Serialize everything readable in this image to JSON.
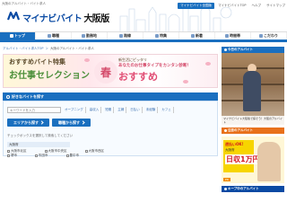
{
  "header": {
    "tagline": "大阪のアルバイト・バイト求人",
    "logo_main": "マイナビ",
    "logo_sub": "バイト",
    "logo_region": "大阪版",
    "top_links": [
      "マイナビバイト全国版",
      "マイナビバイトTOP",
      "ヘルプ",
      "サイトマップ"
    ]
  },
  "nav": {
    "items": [
      "トップ",
      "職種",
      "勤務地",
      "路線",
      "特集",
      "新着",
      "時間帯",
      "こだわり"
    ]
  },
  "breadcrumb": {
    "items": [
      "アルバイト・バイト求人TOP",
      "大阪のアルバイト・バイト求人"
    ]
  },
  "banner": {
    "line1": "おすすめバイト特集",
    "line2": "お仕事セレクション",
    "haru": "春",
    "right1": "新生活にピッタリ",
    "right2": "あなたのお仕事タイプをカンタン診断！",
    "right3": "おすすめ"
  },
  "search": {
    "title": "好きなバイトを探す",
    "keyword_placeholder": "キーワードを入力",
    "chips": [
      "オープニング",
      "高収入",
      "短期",
      "主婦",
      "日払い",
      "未経験",
      "カフェ"
    ],
    "area_button": "エリアから探す",
    "job_button": "職種から探す",
    "hint": "チェックボックスを選択して検索してください",
    "osaka_tab": "大阪府",
    "prefectures_row1": [
      "大阪市北区",
      "大阪市中央区",
      "大阪市西区"
    ],
    "prefectures_row2": [
      "堺市",
      "吹田市",
      "豊中市"
    ]
  },
  "sidebar": {
    "today_title": "今日のアルバイト",
    "today_caption": "マイナビバイト大阪版で探そう！大阪のアルバイト",
    "featured_title": "注目のアルバイト",
    "ad_line1": "週払いOK!",
    "ad_line2": "大阪府",
    "ad_line3": "日収1万円",
    "ad_label": "PR",
    "keep_title": "キープ中のアルバイト"
  }
}
